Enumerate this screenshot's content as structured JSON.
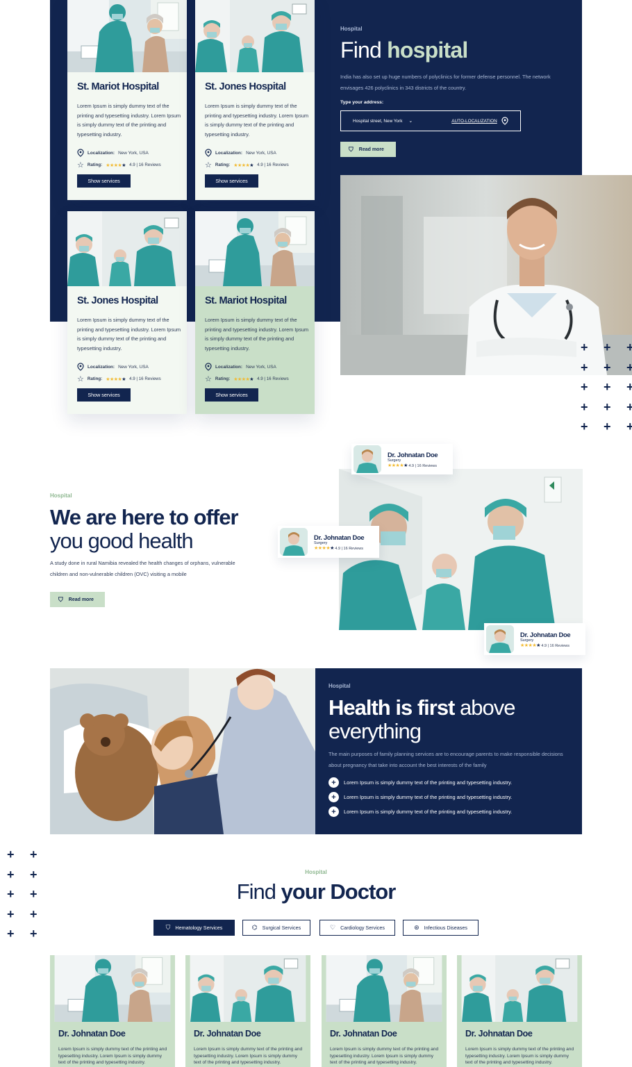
{
  "hospital_cards": [
    {
      "name": "St. Mariot Hospital",
      "desc": "Lorem Ipsum is simply dummy text of the printing and typesetting industry. Lorem Ipsum is simply dummy text of the printing and typesetting industry.",
      "loc_label": "Localization:",
      "loc": "New York, USA",
      "rating_label": "Rating:",
      "rating": "4.9 | 16 Reviews",
      "button": "Show services"
    },
    {
      "name": "St. Jones Hospital",
      "desc": "Lorem Ipsum is simply dummy text of the printing and typesetting industry. Lorem Ipsum is simply dummy text of the printing and typesetting industry.",
      "loc_label": "Localization:",
      "loc": "New York, USA",
      "rating_label": "Rating:",
      "rating": "4.9 | 16 Reviews",
      "button": "Show services"
    },
    {
      "name": "St. Jones Hospital",
      "desc": "Lorem Ipsum is simply dummy text of the printing and typesetting industry. Lorem Ipsum is simply dummy text of the printing and typesetting industry.",
      "loc_label": "Localization:",
      "loc": "New York, USA",
      "rating_label": "Rating:",
      "rating": "4.9 | 16 Reviews",
      "button": "Show services"
    },
    {
      "name": "St. Mariot Hospital",
      "desc": "Lorem Ipsum is simply dummy text of the printing and typesetting industry. Lorem Ipsum is simply dummy text of the printing and typesetting industry.",
      "loc_label": "Localization:",
      "loc": "New York, USA",
      "rating_label": "Rating:",
      "rating": "4.9 | 16 Reviews",
      "button": "Show services"
    }
  ],
  "find_hospital": {
    "kicker": "Hospital",
    "title_light": "Find",
    "title_bold": "hospital",
    "desc": "India has also set up huge numbers of polyclinics for former defense personnel. The network envisages 426 polyclinics in 343 districts of the country.",
    "address_label": "Type your address:",
    "address_value": "Hospital street,  New York",
    "auto_localization": "AUTO-LOCALIZATION",
    "read_more": "Read more"
  },
  "offer": {
    "kicker": "Hospital",
    "title_line1": "We are here to offer",
    "title_line2": "you good health",
    "desc": "A study done in rural Namibia revealed the health changes of orphans, vulnerable children and non-vulnerable children (OVC) visiting a mobile",
    "read_more": "Read more"
  },
  "doctor_chips": [
    {
      "name": "Dr. Johnatan Doe",
      "spec": "Surgery",
      "reviews": "4.9 | 16 Reviews"
    },
    {
      "name": "Dr. Johnatan Doe",
      "spec": "Surgery",
      "reviews": "4.9 | 16 Reviews"
    },
    {
      "name": "Dr. Johnatan Doe",
      "spec": "Surgery",
      "reviews": "4.9 | 16 Reviews"
    }
  ],
  "health_first": {
    "kicker": "Hospital",
    "title_bold": "Health is first",
    "title_light1": "above",
    "title_light2": "everything",
    "desc": "The main purposes of family planning services are to encourage parents to make responsible decisions about pregnancy that take into account the best interests of the family",
    "items": [
      "Lorem Ipsum is simply dummy text of the printing and typesetting industry.",
      "Lorem Ipsum is simply dummy text of the printing and typesetting industry.",
      "Lorem Ipsum is simply dummy text of the printing and typesetting industry."
    ]
  },
  "find_doctor": {
    "kicker": "Hospital",
    "title_light": "Find",
    "title_bold": "your Doctor",
    "tabs": [
      "Hematology Services",
      "Surgical Services",
      "Cardiology Services",
      "Infectious Diseases"
    ],
    "doctors": [
      {
        "name": "Dr. Johnatan Doe",
        "desc": "Lorem Ipsum is simply dummy text of the printing and typesetting industry. Lorem Ipsum is simply dummy text of the printing and typesetting industry."
      },
      {
        "name": "Dr. Johnatan Doe",
        "desc": "Lorem Ipsum is simply dummy text of the printing and typesetting industry. Lorem Ipsum is simply dummy text of the printing and typesetting industry."
      },
      {
        "name": "Dr. Johnatan Doe",
        "desc": "Lorem Ipsum is simply dummy text of the printing and typesetting industry. Lorem Ipsum is simply dummy text of the printing and typesetting industry."
      },
      {
        "name": "Dr. Johnatan Doe",
        "desc": "Lorem Ipsum is simply dummy text of the printing and typesetting industry. Lorem Ipsum is simply dummy text of the printing and typesetting industry."
      }
    ]
  },
  "colors": {
    "navy": "#12254f",
    "mint": "#c9dfc8",
    "teal_scrubs": "#3aa8a4",
    "star": "#f2b92e"
  }
}
